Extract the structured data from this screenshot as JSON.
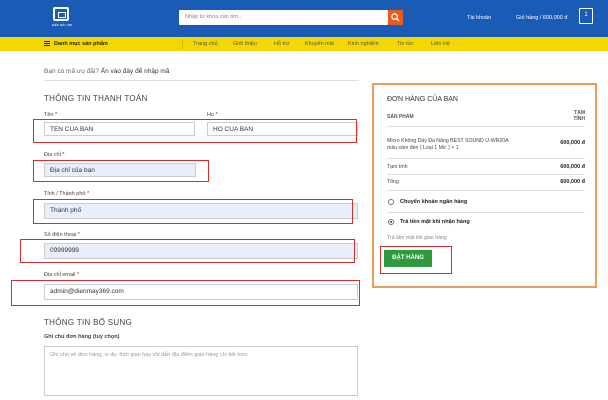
{
  "header": {
    "logo_text": "ĐIỆN MÁY 369",
    "search_placeholder": "Nhập từ khóa cần tìm...",
    "account_label": "Tài khoản",
    "cart_label": "Giỏ hàng / 600,000 đ",
    "cart_count": "1",
    "brand_color": "#1a5bb6",
    "nav_color": "#f5d800",
    "search_button_color": "#e85c20"
  },
  "nav": {
    "category_label": "Danh mục sản phẩm",
    "items": [
      "Trang chủ",
      "Giới thiệu",
      "Hỗ trợ",
      "Khuyến mãi",
      "Kinh nghiệm",
      "Tin tức",
      "Liên Hệ"
    ]
  },
  "coupon": {
    "prompt": "Bạn có mã ưu đãi?",
    "link": "Ấn vào đây để nhập mã"
  },
  "billing": {
    "title": "THÔNG TIN THANH TOÁN",
    "first_name_label": "Tên",
    "first_name_value": "TEN CUA BAN",
    "last_name_label": "Họ",
    "last_name_value": "HO CUA BAN",
    "address_label": "Địa chỉ",
    "address_value": "Địa chỉ của bạn",
    "city_label": "Tỉnh / Thành phố",
    "city_value": "Thành phố",
    "phone_label": "Số điện thoại",
    "phone_value": "09999999",
    "email_label": "Địa chỉ email",
    "email_value": "admin@dienmay369.com",
    "required_mark": "*"
  },
  "additional": {
    "title": "THÔNG TIN BỔ SUNG",
    "notes_label": "Ghi chú đơn hàng (tuỳ chọn)",
    "notes_placeholder": "Ghi chú về đơn hàng, ví dụ: thời gian hay chỉ dẫn địa điểm giao hàng chi tiết hơn."
  },
  "order": {
    "title": "ĐƠN HÀNG CỦA BẠN",
    "col_product": "SẢN PHẨM",
    "col_total_1": "TẠM",
    "col_total_2": "TÍNH",
    "product_line_1": "Micro Không Dây Đa Năng BEST SOUND U-WR20A",
    "product_line_2": "màu xám đen ( Loại 1 Mic ) × 1",
    "product_price": "600,000 đ",
    "subtotal_label": "Tạm tính",
    "subtotal_value": "600,000 đ",
    "total_label": "Tổng",
    "total_value": "600,000 đ",
    "payment_bank": "Chuyển khoản ngân hàng",
    "payment_cod": "Trả tiền mặt khi nhận hàng",
    "payment_note": "Trả tiền mặt khi giao hàng",
    "place_order": "ĐẶT HÀNG",
    "border_color": "#e89f5a",
    "button_color": "#2e9a3e"
  }
}
